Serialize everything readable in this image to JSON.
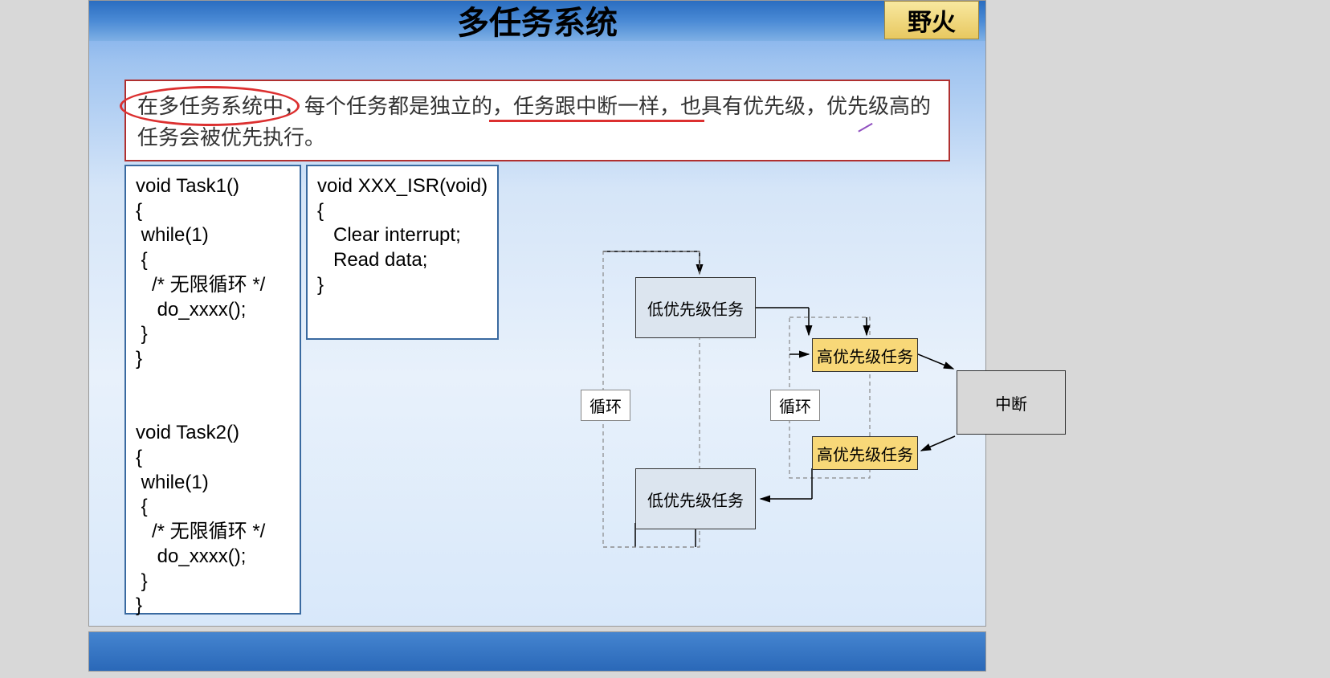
{
  "title": "多任务系统",
  "logo": "野火",
  "note": "在多任务系统中，每个任务都是独立的，任务跟中断一样，也具有优先级，优先级高的任务会被优先执行。",
  "code1": "void Task1()\n{\n while(1)\n {\n   /* 无限循环 */\n    do_xxxx();\n }\n}\n\n\nvoid Task2()\n{\n while(1)\n {\n   /* 无限循环 */\n    do_xxxx();\n }\n}",
  "code2": "void XXX_ISR(void)\n{\n   Clear interrupt;\n   Read data;\n}",
  "diagram": {
    "low_priority": "低优先级任务",
    "high_priority": "高优先级任务",
    "interrupt": "中断",
    "loop": "循环"
  }
}
